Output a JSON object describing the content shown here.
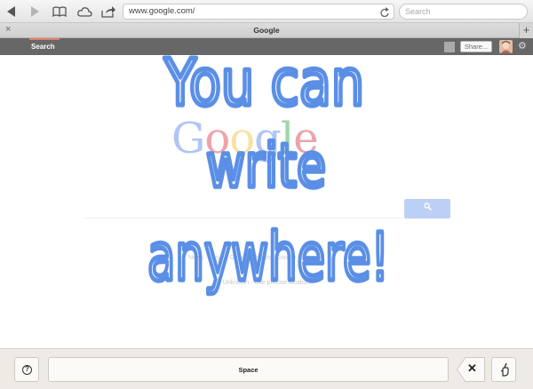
{
  "browser": {
    "url": "www.google.com/",
    "search_placeholder": "Search",
    "tab_title": "Google",
    "new_tab_label": "+"
  },
  "google_bar": {
    "search_label": "Search",
    "share_label": "Share..."
  },
  "google_page": {
    "logo_text": "Google",
    "logo_colors": [
      "#3369e8",
      "#d50f25",
      "#eeb211",
      "#3369e8",
      "#009925",
      "#d50f25"
    ],
    "links_text": "News · Drive · Gmail · Photos · Google Play",
    "location_text": "Unknown - Use precise location"
  },
  "handwriting": {
    "lines": [
      "You can",
      "write",
      "anywhere!"
    ],
    "color": "#5b8fe6"
  },
  "keyboard": {
    "space_label": "Space",
    "help_label": "?",
    "delete_label": "✕"
  }
}
